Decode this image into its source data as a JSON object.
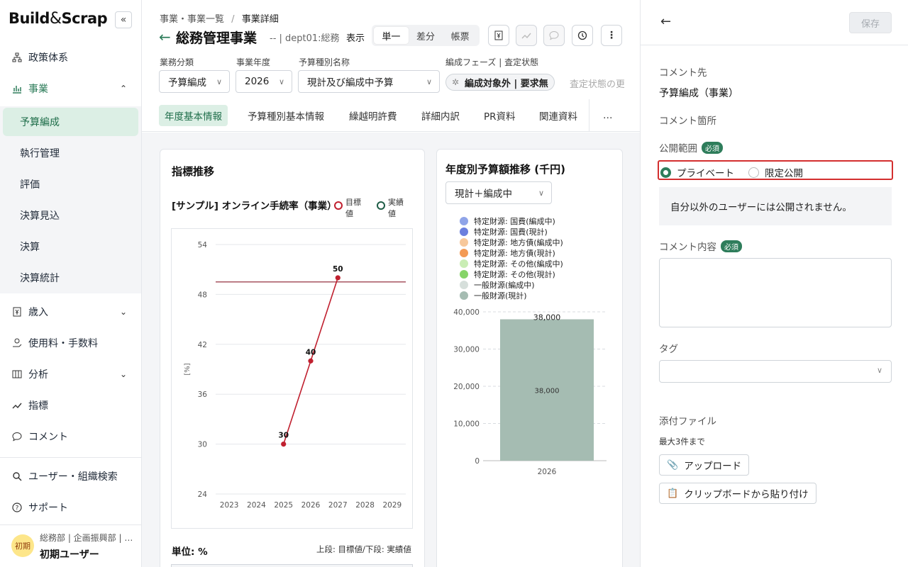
{
  "app": {
    "logo": "Build&Scrap",
    "logo_left": "Build",
    "logo_amp": "&",
    "logo_right": "Scrap"
  },
  "sidebar": {
    "items": [
      {
        "label": "政策体系"
      },
      {
        "label": "事業"
      },
      {
        "label": "歳入"
      },
      {
        "label": "使用料・手数料"
      },
      {
        "label": "分析"
      },
      {
        "label": "指標"
      },
      {
        "label": "コメント"
      }
    ],
    "sub_items": [
      {
        "label": "予算編成"
      },
      {
        "label": "執行管理"
      },
      {
        "label": "評価"
      },
      {
        "label": "決算見込"
      },
      {
        "label": "決算"
      },
      {
        "label": "決算統計"
      }
    ],
    "bottom": [
      {
        "label": "ユーザー・組織検索"
      },
      {
        "label": "サポート"
      }
    ],
    "user": {
      "avatar": "初期",
      "org": "総務部 | 企画振興部 | …",
      "name": "初期ユーザー"
    }
  },
  "header": {
    "crumb_parent": "事業・事業一覧",
    "crumb_sep": "/",
    "crumb_current": "事業詳細",
    "title": "総務管理事業",
    "meta": "-- | dept01:総務",
    "view_label": "表示",
    "view_modes": [
      "単一",
      "差分",
      "帳票"
    ]
  },
  "filters": {
    "category_label": "業務分類",
    "category_value": "予算編成",
    "year_label": "事業年度",
    "year_value": "2026",
    "type_label": "予算種別名称",
    "type_value": "現計及び編成中予算",
    "phase_label": "編成フェーズ | 査定状態",
    "phase_value": "編成対象外 | 要求無",
    "phase_extra": "査定状態の更新"
  },
  "tabs": [
    "年度基本情報",
    "予算種別基本情報",
    "繰越明許費",
    "詳細内訳",
    "PR資料",
    "関連資料",
    "…"
  ],
  "indicator_card": {
    "title": "指標推移",
    "subtitle": "[サンプル] オンライン手続率（事業）",
    "legend_target_1": "目標",
    "legend_target_2": "値",
    "legend_actual_1": "実績",
    "legend_actual_2": "値",
    "unit": "単位: %",
    "unit_note": "上段: 目標値/下段: 実績値"
  },
  "budget_card": {
    "title": "年度別予算額推移 (千円)",
    "select_value": "現計＋編成中"
  },
  "chart_data": [
    {
      "type": "line",
      "title": "[サンプル] オンライン手続率（事業）",
      "ylabel": "[%]",
      "x": [
        "2023",
        "2024",
        "2025",
        "2026",
        "2027",
        "2028",
        "2029"
      ],
      "ylim": [
        24,
        54
      ],
      "yticks": [
        "54",
        "48",
        "42",
        "36",
        "30",
        "24"
      ],
      "target_line": 49.5,
      "series": [
        {
          "name": "目標値",
          "values": [
            null,
            null,
            null,
            null,
            null,
            null,
            null
          ],
          "color": "#c0202f"
        },
        {
          "name": "実績値",
          "values": [
            null,
            null,
            30,
            40,
            50,
            null,
            null
          ],
          "labels": [
            "30",
            "40",
            "50"
          ],
          "color": "#c0202f"
        }
      ],
      "grid": true
    },
    {
      "type": "bar",
      "title": "年度別予算額推移 (千円)",
      "categories": [
        "2026"
      ],
      "ylim": [
        0,
        40000
      ],
      "yticks": [
        "40,000",
        "30,000",
        "20,000",
        "10,000",
        "0"
      ],
      "series": [
        {
          "name": "特定財源: 国費(編成中)",
          "color": "#8fa4e8",
          "values": [
            0
          ]
        },
        {
          "name": "特定財源: 国費(現計)",
          "color": "#6b7fde",
          "values": [
            0
          ]
        },
        {
          "name": "特定財源: 地方債(編成中)",
          "color": "#f7c89b",
          "values": [
            0
          ]
        },
        {
          "name": "特定財源: 地方債(現計)",
          "color": "#f39a54",
          "values": [
            0
          ]
        },
        {
          "name": "特定財源: その他(編成中)",
          "color": "#c9edb4",
          "values": [
            0
          ]
        },
        {
          "name": "特定財源: その他(現計)",
          "color": "#86d468",
          "values": [
            0
          ]
        },
        {
          "name": "一般財源(編成中)",
          "color": "#d6dfdb",
          "values": [
            0
          ]
        },
        {
          "name": "一般財源(現計)",
          "color": "#a5bcb2",
          "values": [
            38000
          ]
        }
      ],
      "total_label": "38,000",
      "inner_label": "38,000",
      "grid": true,
      "legend": "top"
    }
  ],
  "panel": {
    "save": "保存",
    "target_label": "コメント先",
    "target_value": "予算編成（事業）",
    "location_label": "コメント箇所",
    "scope_label": "公開範囲",
    "required": "必須",
    "radio_private": "プライベート",
    "radio_limited": "限定公開",
    "info": "自分以外のユーザーには公開されません。",
    "content_label": "コメント内容",
    "tag_label": "タグ",
    "attach_label": "添付ファイル",
    "attach_limit": "最大3件まで",
    "upload": "アップロード",
    "paste": "クリップボードから貼り付け"
  },
  "colors": {
    "accent": "#2e7d5b",
    "line": "#c0202f",
    "highlight": "#d32f2f"
  }
}
